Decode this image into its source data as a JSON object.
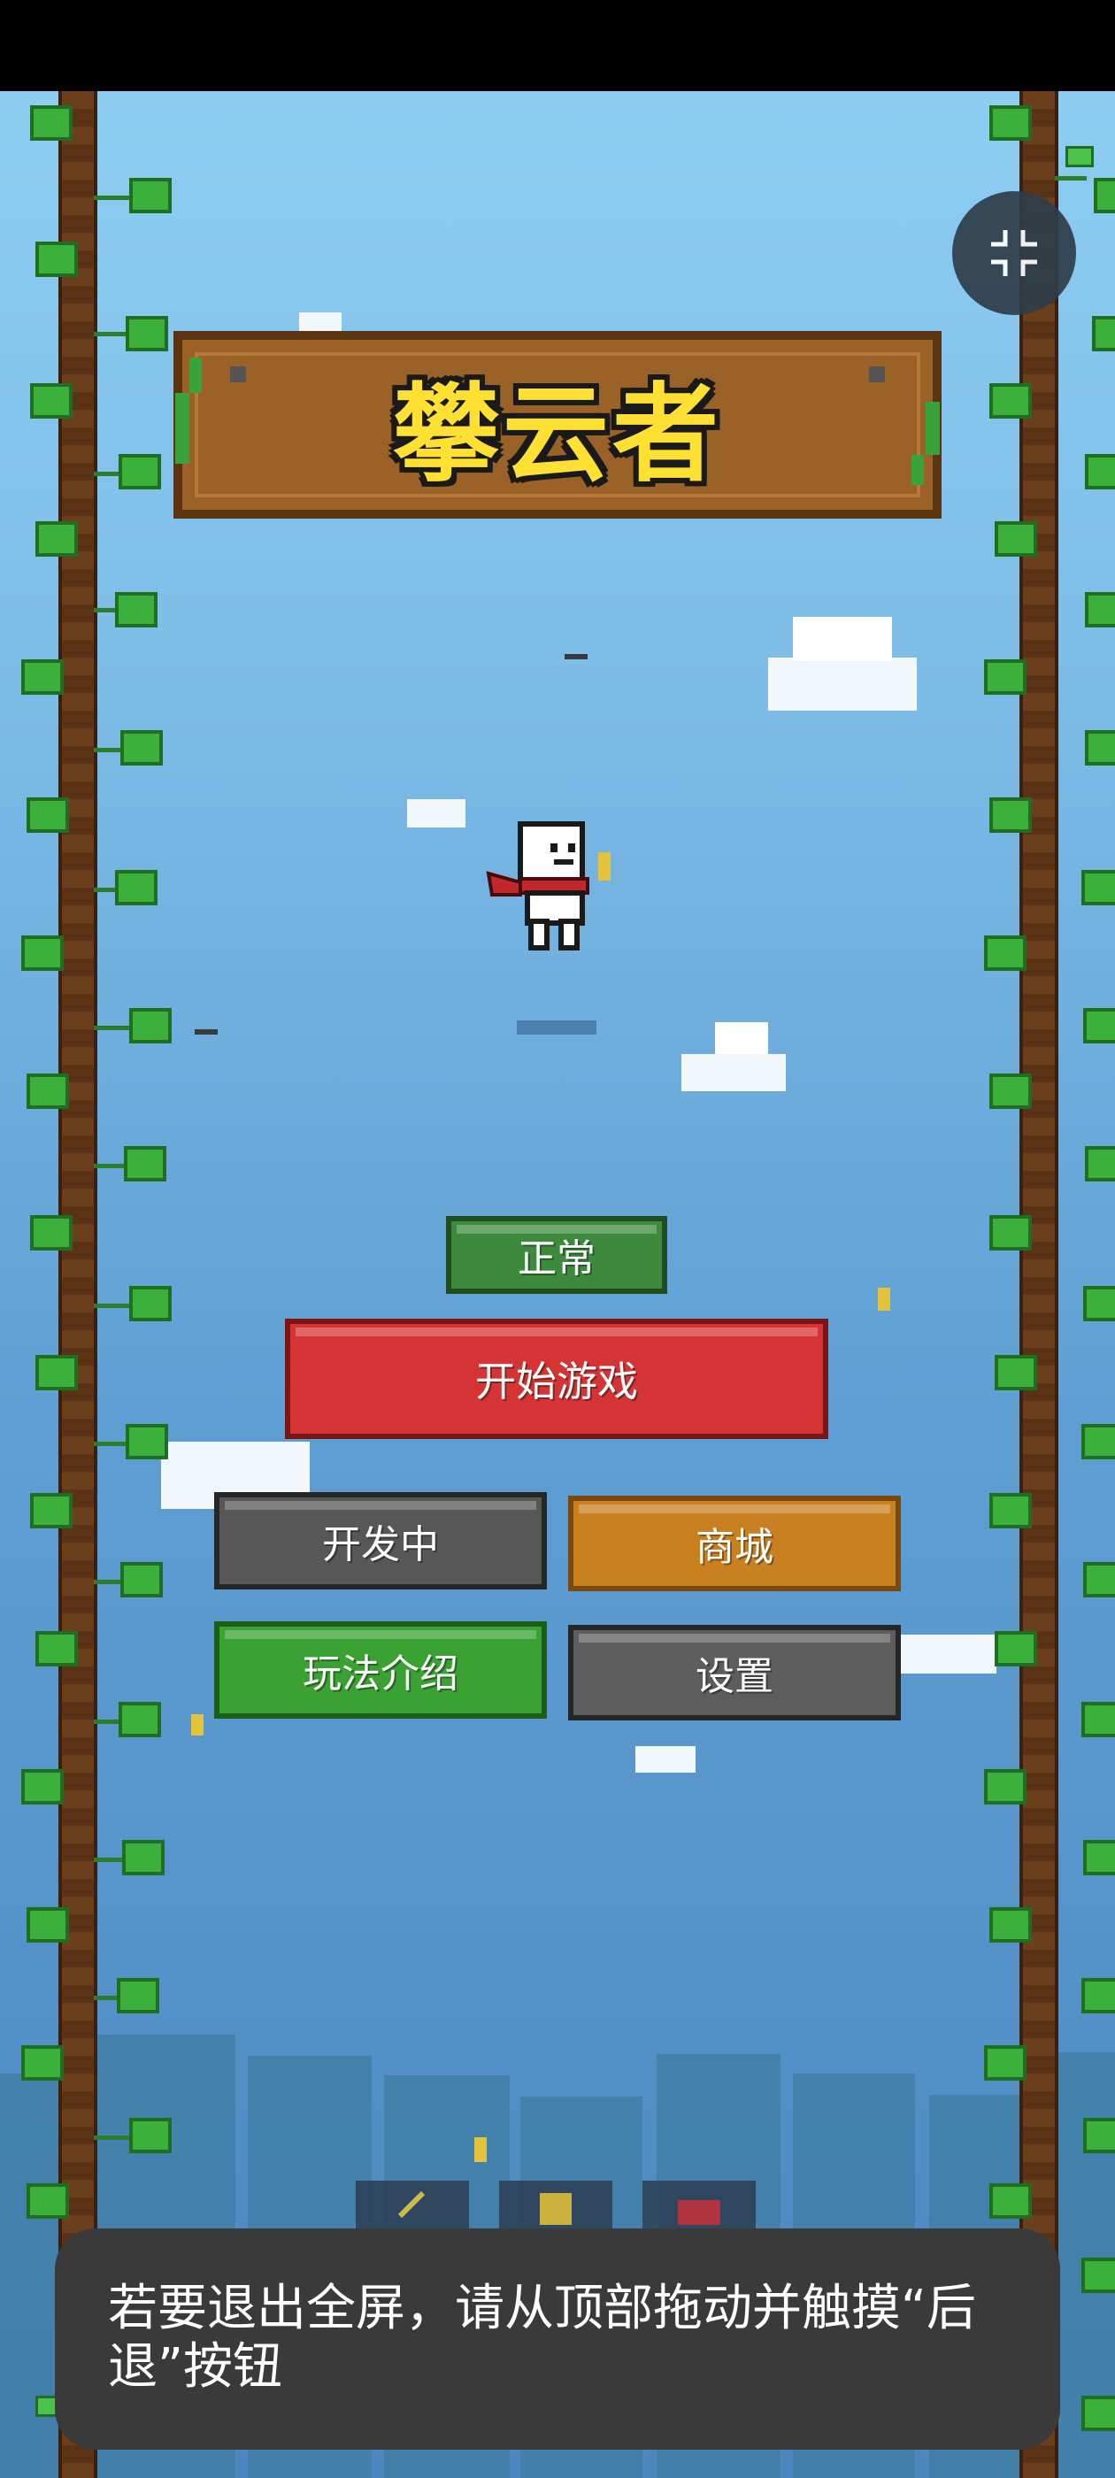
{
  "game": {
    "title": "攀云者"
  },
  "menu": {
    "mode_label": "正常",
    "start_label": "开始游戏",
    "dev_label": "开发中",
    "shop_label": "商城",
    "help_label": "玩法介绍",
    "settings_label": "设置"
  },
  "toast": {
    "message": "若要退出全屏，请从顶部拖动并触摸“后退”按钮"
  },
  "icons": {
    "exit_fullscreen": "exit-fullscreen-icon",
    "bottom_1": "sword-icon",
    "bottom_2": "trophy-icon",
    "bottom_3": "bow-icon"
  },
  "colors": {
    "start_button": "#d43434",
    "mode_button": "#3d8a3c",
    "shop_button": "#c88020",
    "help_button": "#3aa133",
    "gray_button": "#575757",
    "title_text": "#ffe033",
    "title_board": "#9a6226"
  }
}
